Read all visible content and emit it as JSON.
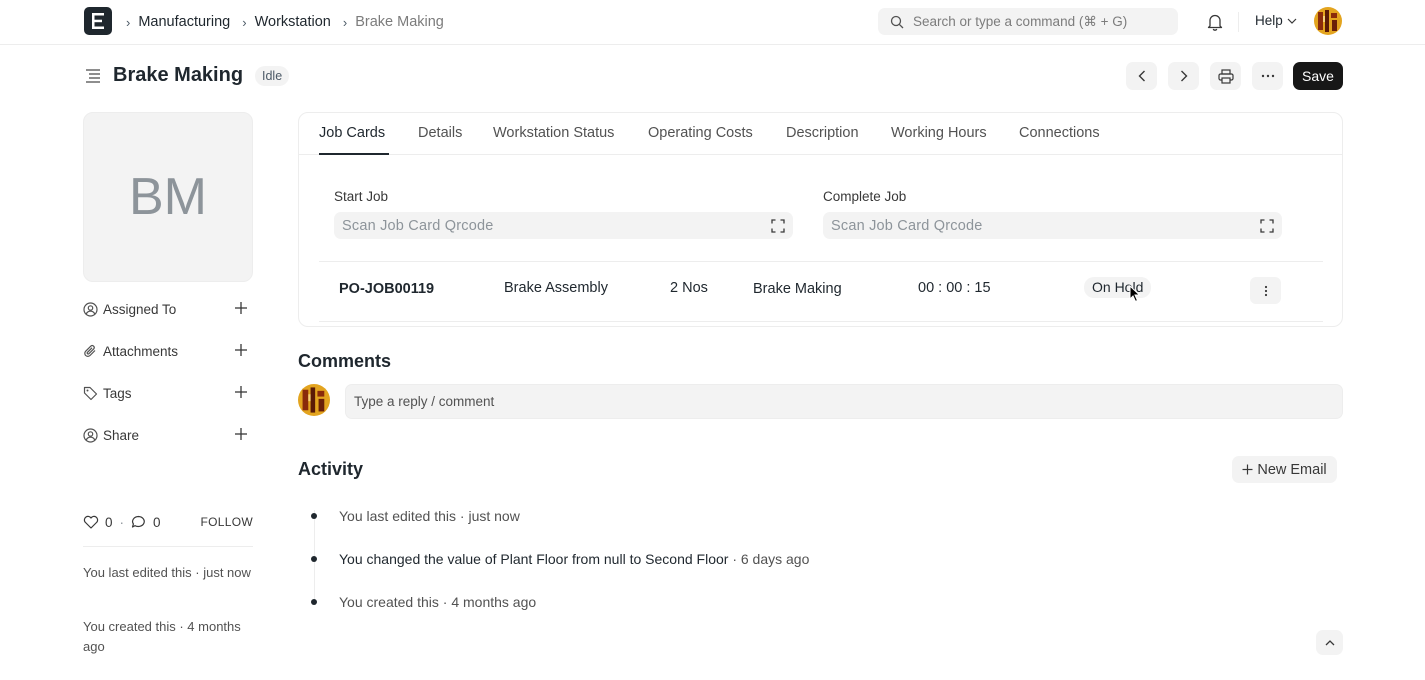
{
  "navbar": {
    "breadcrumbs": [
      "Manufacturing",
      "Workstation",
      "Brake Making"
    ],
    "search_placeholder": "Search or type a command (⌘ + G)",
    "help_label": "Help"
  },
  "page": {
    "title": "Brake Making",
    "status": "Idle",
    "save_label": "Save"
  },
  "sidebar": {
    "image_initials": "BM",
    "items": [
      {
        "label": "Assigned To",
        "icon": "assign-icon"
      },
      {
        "label": "Attachments",
        "icon": "paperclip-icon"
      },
      {
        "label": "Tags",
        "icon": "tag-icon"
      },
      {
        "label": "Share",
        "icon": "share-icon"
      }
    ],
    "likes": "0",
    "comments": "0",
    "follow_label": "FOLLOW",
    "last_edited": "You last edited this · just now",
    "created": "You created this · 4 months ago"
  },
  "tabs": [
    "Job Cards",
    "Details",
    "Workstation Status",
    "Operating Costs",
    "Description",
    "Working Hours",
    "Connections"
  ],
  "job_cards": {
    "start_label": "Start Job",
    "start_placeholder": "Scan Job Card Qrcode",
    "complete_label": "Complete Job",
    "complete_placeholder": "Scan Job Card Qrcode",
    "row": {
      "id": "PO-JOB00119",
      "operation": "Brake Assembly",
      "qty": "2 Nos",
      "workstation": "Brake Making",
      "timer": "00 : 00 : 15",
      "status": "On Hold"
    }
  },
  "comments": {
    "title": "Comments",
    "placeholder": "Type a reply / comment"
  },
  "activity": {
    "title": "Activity",
    "new_email_label": "New Email",
    "items": [
      {
        "text": "You last edited this · just now"
      },
      {
        "pre": "You changed the value of ",
        "field": "Plant Floor",
        "mid1": " from ",
        "from": "null",
        "mid2": " to ",
        "to": "Second Floor",
        "post": " · 6 days ago"
      },
      {
        "text": "You created this · 4 months ago"
      }
    ]
  },
  "colors": {
    "primary_dark": "#171717",
    "muted_bg": "#f3f3f3",
    "border": "#ededed"
  }
}
